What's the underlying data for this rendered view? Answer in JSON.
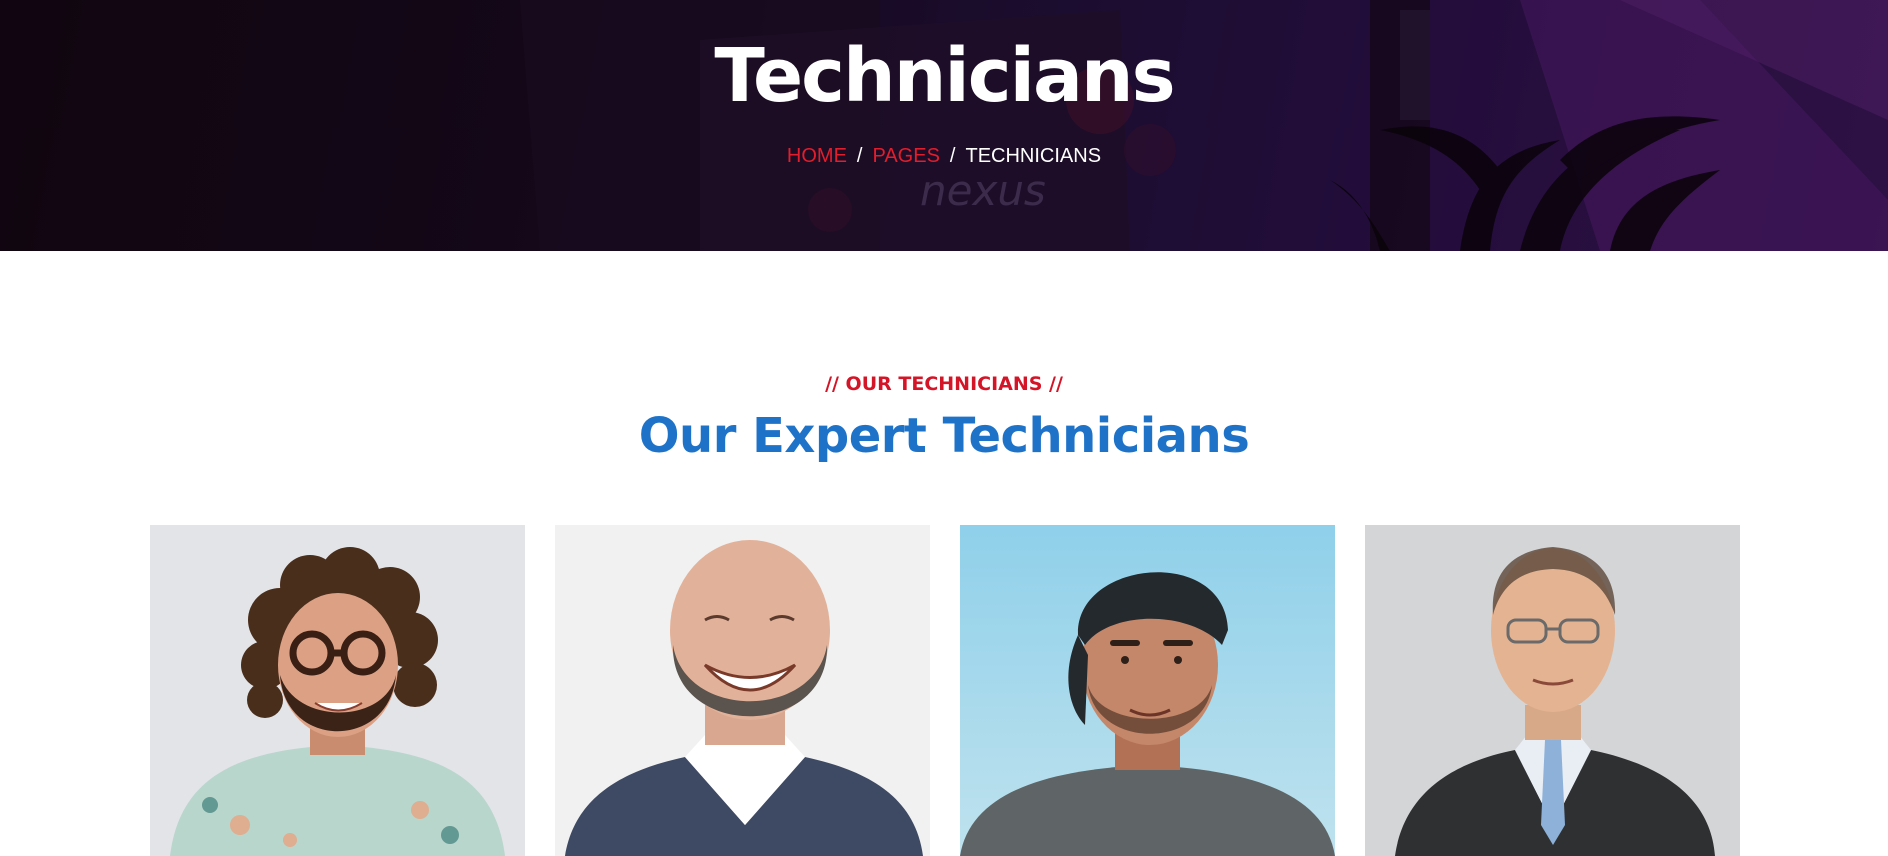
{
  "hero": {
    "title": "Technicians",
    "breadcrumb": {
      "home": "HOME",
      "pages": "PAGES",
      "current": "TECHNICIANS",
      "separator": "/"
    },
    "background_sign_text": "nexus"
  },
  "section": {
    "kicker": "// OUR TECHNICIANS //",
    "title": "Our Expert Technicians"
  },
  "technicians": [
    {
      "photo": "technician-photo-curly-hair-glasses"
    },
    {
      "photo": "technician-photo-bald-beard-laughing"
    },
    {
      "photo": "technician-photo-cap-backwards"
    },
    {
      "photo": "technician-photo-suit-glasses"
    }
  ],
  "colors": {
    "accent_red": "#e21d2c",
    "title_blue": "#1e73c9",
    "hero_dark": "#170a1c",
    "hero_purple": "#3a1657"
  }
}
